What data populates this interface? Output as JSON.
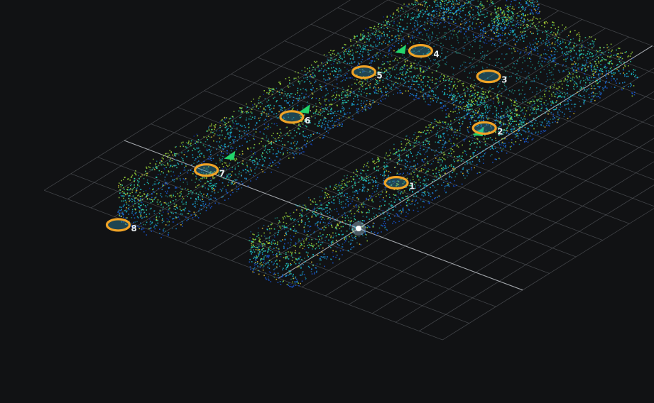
{
  "viewer": {
    "background_color": "#111214",
    "grid_color": "#5a5d62",
    "axis_color": "#cfd3d8",
    "point_cloud_palette": [
      "#0b2a8f",
      "#1a5bd6",
      "#1f93d8",
      "#19c2d0",
      "#2fd6a8",
      "#9ad63a",
      "#e2c43a"
    ]
  },
  "waypoints": {
    "marker_color": "#f0a326",
    "items": [
      {
        "label": "1"
      },
      {
        "label": "2"
      },
      {
        "label": "3"
      },
      {
        "label": "4"
      },
      {
        "label": "5"
      },
      {
        "label": "6"
      },
      {
        "label": "7"
      },
      {
        "label": "8"
      }
    ]
  },
  "direction_arrows": {
    "color": "#22d46a",
    "count": 4
  }
}
